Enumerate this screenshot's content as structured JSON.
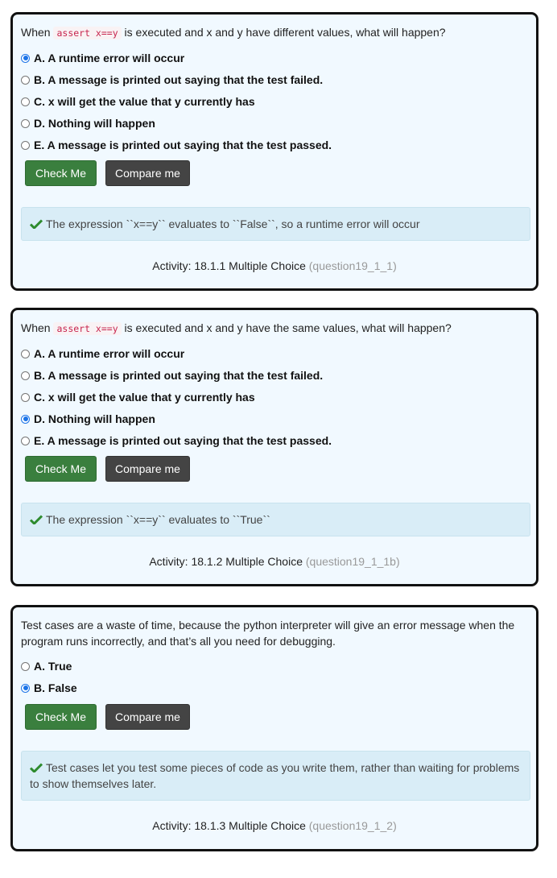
{
  "questions": [
    {
      "prompt_before": "When ",
      "code": "assert x==y",
      "prompt_after": " is executed and x and y have different values, what will happen?",
      "options": [
        {
          "label": "A. A runtime error will occur",
          "checked": true
        },
        {
          "label": "B. A message is printed out saying that the test failed.",
          "checked": false
        },
        {
          "label": "C. x will get the value that y currently has",
          "checked": false
        },
        {
          "label": "D. Nothing will happen",
          "checked": false
        },
        {
          "label": "E. A message is printed out saying that the test passed.",
          "checked": false
        }
      ],
      "check_label": "Check Me",
      "compare_label": "Compare me",
      "feedback": "The expression ``x==y`` evaluates to ``False``, so a runtime error will occur",
      "activity_label": "Activity: 18.1.1 Multiple Choice",
      "activity_id": "(question19_1_1)"
    },
    {
      "prompt_before": "When ",
      "code": "assert x==y",
      "prompt_after": " is executed and x and y have the same values, what will happen?",
      "options": [
        {
          "label": "A. A runtime error will occur",
          "checked": false
        },
        {
          "label": "B. A message is printed out saying that the test failed.",
          "checked": false
        },
        {
          "label": "C. x will get the value that y currently has",
          "checked": false
        },
        {
          "label": "D. Nothing will happen",
          "checked": true
        },
        {
          "label": "E. A message is printed out saying that the test passed.",
          "checked": false
        }
      ],
      "check_label": "Check Me",
      "compare_label": "Compare me",
      "feedback": "The expression ``x==y`` evaluates to ``True``",
      "activity_label": "Activity: 18.1.2 Multiple Choice",
      "activity_id": "(question19_1_1b)"
    },
    {
      "prompt_text": "Test cases are a waste of time, because the python interpreter will give an error message when the program runs incorrectly, and that’s all you need for debugging.",
      "options": [
        {
          "label": "A. True",
          "checked": false
        },
        {
          "label": "B. False",
          "checked": true
        }
      ],
      "check_label": "Check Me",
      "compare_label": "Compare me",
      "feedback": "Test cases let you test some pieces of code as you write them, rather than waiting for problems to show themselves later.",
      "activity_label": "Activity: 18.1.3 Multiple Choice",
      "activity_id": "(question19_1_2)"
    }
  ],
  "colors": {
    "card_bg": "#f1f9ff",
    "check_button": "#3a7f3e",
    "compare_button": "#444444",
    "feedback_bg": "#d9edf7",
    "check_icon": "#2e8b2e",
    "radio_selected": "#1a73e8"
  },
  "icons": {
    "feedback_icon": "checkmark-icon"
  }
}
